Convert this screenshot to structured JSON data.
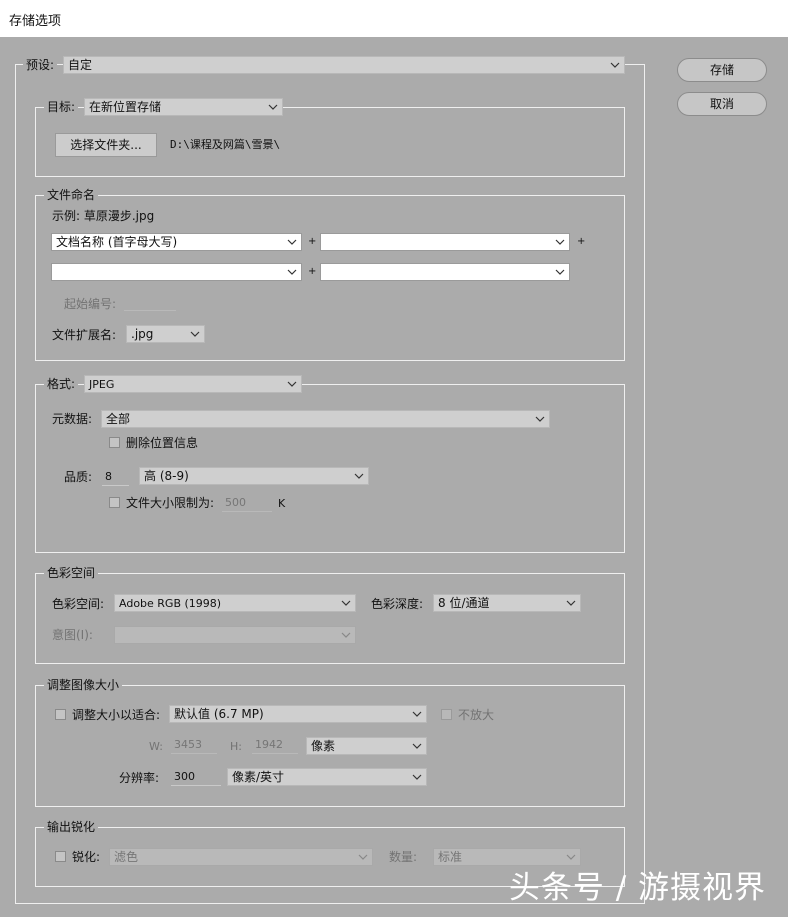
{
  "window": {
    "title": "存储选项"
  },
  "preset": {
    "label": "预设:",
    "value": "自定"
  },
  "buttons": {
    "save": "存储",
    "cancel": "取消"
  },
  "target": {
    "legend": "目标:",
    "value": "在新位置存储",
    "choose_folder": "选择文件夹...",
    "path": "D:\\课程及网篇\\雪景\\"
  },
  "naming": {
    "legend": "文件命名",
    "example": "示例: 草原漫步.jpg",
    "field1": "文档名称 (首字母大写)",
    "field2": "",
    "field3": "",
    "field4": "",
    "plus": "+",
    "start_number_label": "起始编号:",
    "ext_label": "文件扩展名:",
    "ext_value": ".jpg"
  },
  "format": {
    "legend": "格式:",
    "value": "JPEG",
    "metadata_label": "元数据:",
    "metadata_value": "全部",
    "remove_location": "删除位置信息",
    "quality_label": "品质:",
    "quality_number": "8",
    "quality_value": "高 (8-9)",
    "size_limit_label": "文件大小限制为:",
    "size_limit_value": "500",
    "size_limit_unit": "K"
  },
  "color": {
    "legend": "色彩空间",
    "space_label": "色彩空间:",
    "space_value": "Adobe RGB (1998)",
    "depth_label": "色彩深度:",
    "depth_value": "8 位/通道",
    "intent_label": "意图(Ⅰ):",
    "intent_value": ""
  },
  "resize": {
    "legend": "调整图像大小",
    "fit_label": "调整大小以适合:",
    "fit_value": "默认值 (6.7 MP)",
    "no_enlarge": "不放大",
    "w_label": "W:",
    "w_value": "3453",
    "h_label": "H:",
    "h_value": "1942",
    "unit_value": "像素",
    "res_label": "分辨率:",
    "res_value": "300",
    "res_unit": "像素/英寸"
  },
  "sharpen": {
    "legend": "输出锐化",
    "label": "锐化:",
    "value": "滤色",
    "amount_label": "数量:",
    "amount_value": "标准"
  },
  "watermark": "头条号 / 游摄视界"
}
